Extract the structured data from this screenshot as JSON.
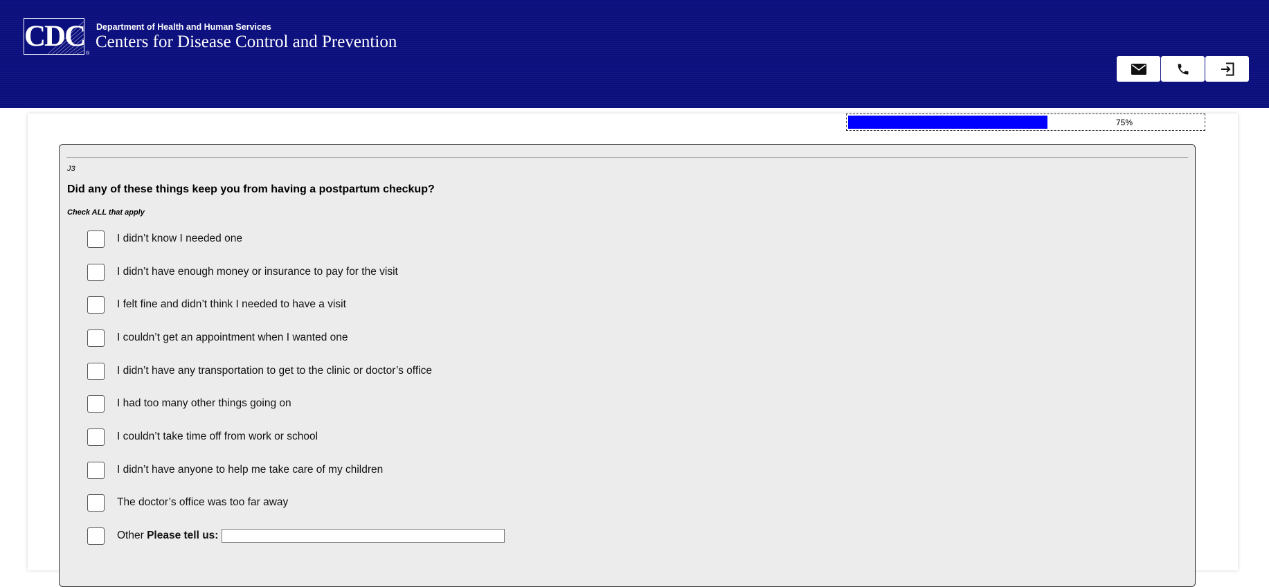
{
  "header": {
    "logo_text": "CDC",
    "department": "Department of Health and Human Services",
    "agency": "Centers for Disease Control and Prevention",
    "background_color": "#0b0f7d",
    "buttons": [
      {
        "icon": "mail-icon"
      },
      {
        "icon": "phone-icon"
      },
      {
        "icon": "exit-icon"
      }
    ]
  },
  "progress": {
    "value": 0.75,
    "label": "75%",
    "color": "#0000ff"
  },
  "question": {
    "number": "J3",
    "text": "Did any of these things keep you from having a postpartum checkup?",
    "instruction": "Check ALL that apply",
    "options": [
      {
        "label": "I didn’t know I needed one",
        "checked": false
      },
      {
        "label": "I didn’t have enough money or insurance to pay for the visit",
        "checked": false
      },
      {
        "label": "I felt fine and didn’t think I needed to have a visit",
        "checked": false
      },
      {
        "label": "I couldn’t get an appointment when I wanted one",
        "checked": false
      },
      {
        "label": "I didn’t have any transportation to get to the clinic or doctor’s office",
        "checked": false
      },
      {
        "label": "I had too many other things going on",
        "checked": false
      },
      {
        "label": "I couldn’t take time off from work or school",
        "checked": false
      },
      {
        "label": "I didn’t have anyone to help me take care of my children",
        "checked": false
      },
      {
        "label": "The doctor’s office was too far away",
        "checked": false
      }
    ],
    "other": {
      "label": "Other",
      "prompt": "Please tell us:",
      "value": "",
      "checked": false
    }
  }
}
